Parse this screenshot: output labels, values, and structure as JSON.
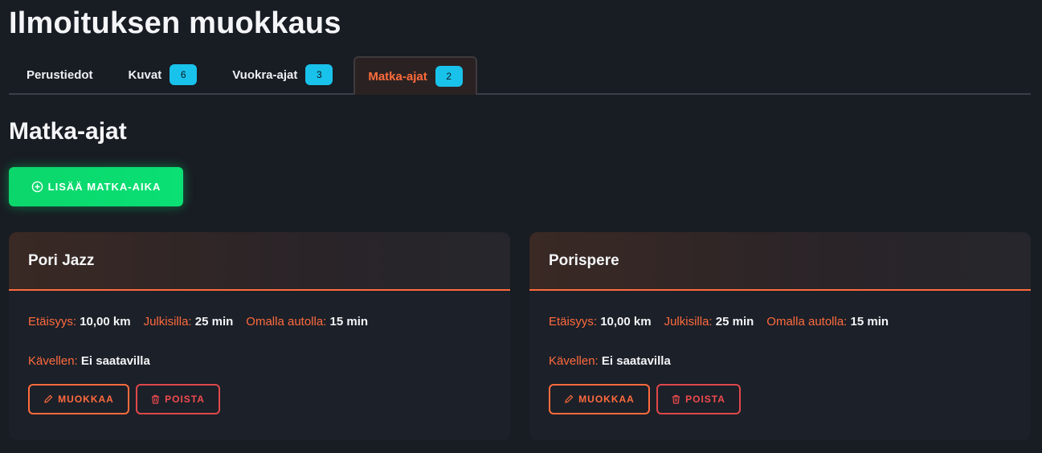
{
  "page": {
    "title": "Ilmoituksen muokkaus"
  },
  "tabs": [
    {
      "label": "Perustiedot",
      "badge": ""
    },
    {
      "label": "Kuvat",
      "badge": "6"
    },
    {
      "label": "Vuokra-ajat",
      "badge": "3"
    },
    {
      "label": "Matka-ajat",
      "badge": "2"
    }
  ],
  "active_tab": "Matka-ajat",
  "section": {
    "title": "Matka-ajat",
    "add_button": "LISÄÄ MATKA-AIKA"
  },
  "labels": {
    "distance": "Etäisyys:",
    "public": "Julkisilla:",
    "car": "Omalla autolla:",
    "walk": "Kävellen:",
    "edit": "MUOKKAA",
    "delete": "POISTA"
  },
  "cards": [
    {
      "name": "Pori Jazz",
      "distance": "10,00 km",
      "public": "25 min",
      "car": "15 min",
      "walk": "Ei saatavilla"
    },
    {
      "name": "Porispere",
      "distance": "10,00 km",
      "public": "25 min",
      "car": "15 min",
      "walk": "Ei saatavilla"
    }
  ],
  "colors": {
    "accent": "#ff6b3d",
    "badge": "#19c2ea",
    "add_button": "#0bd66b",
    "danger": "#e0484a",
    "background": "#181c23"
  },
  "icons": {
    "add": "plus-circle-icon",
    "edit": "pencil-icon",
    "delete": "trash-icon"
  }
}
